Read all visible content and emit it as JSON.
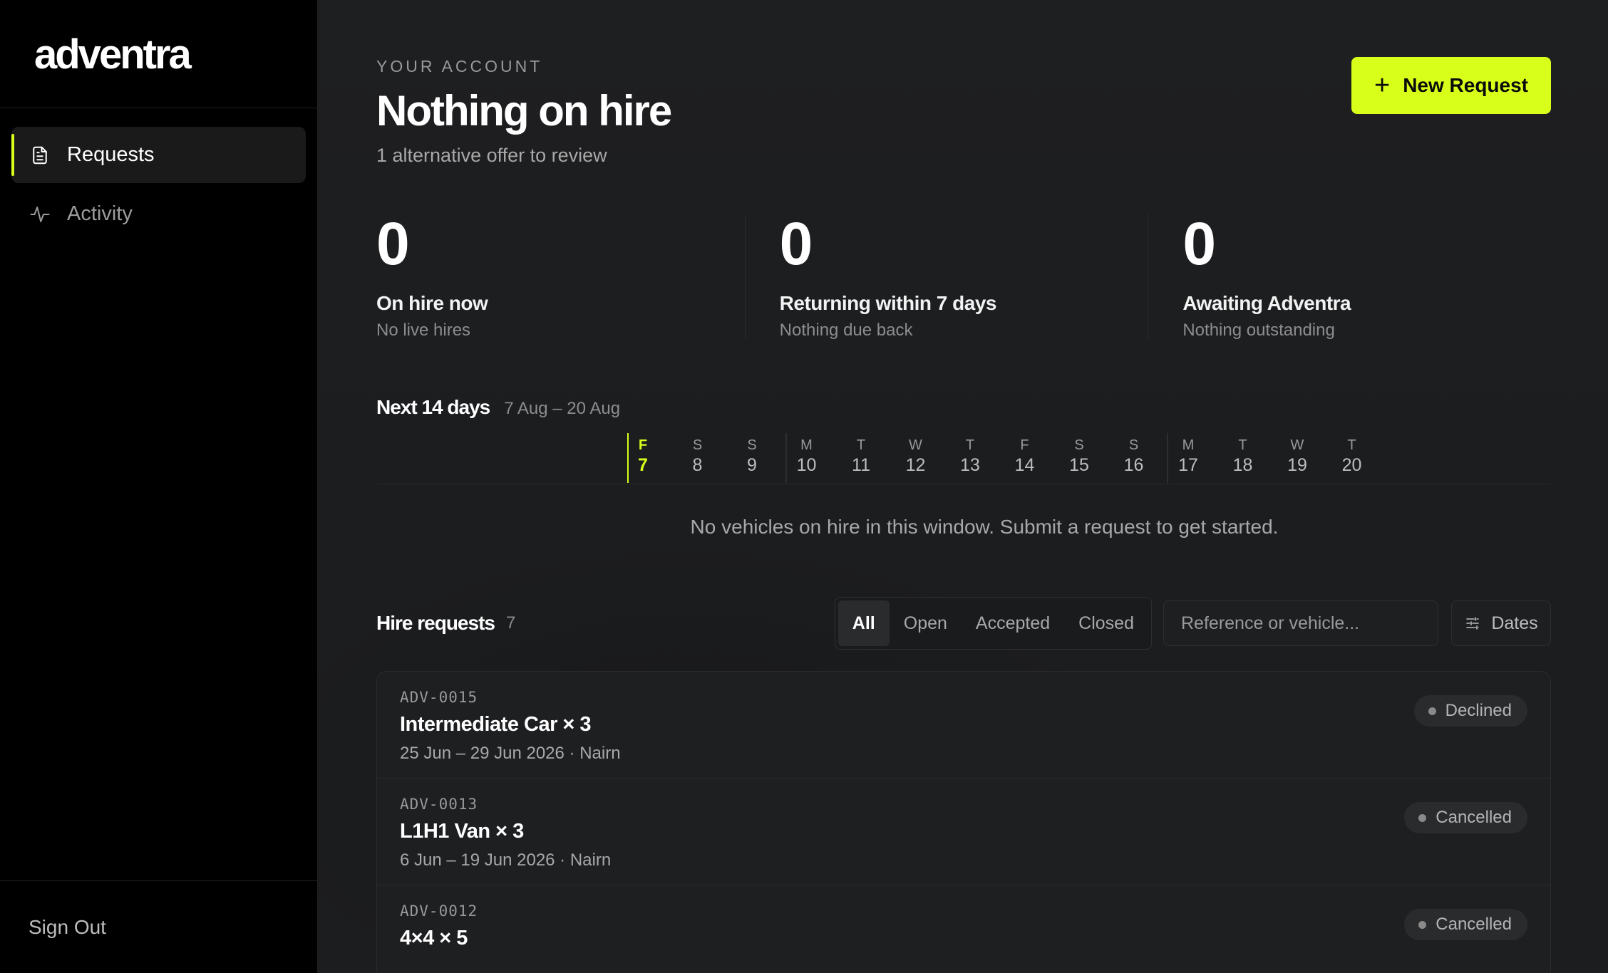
{
  "brand": {
    "logo": "adventra"
  },
  "sidebar": {
    "items": [
      {
        "label": "Requests",
        "icon": "document-icon",
        "active": true
      },
      {
        "label": "Activity",
        "icon": "activity-icon",
        "active": false
      }
    ],
    "sign_out": "Sign Out"
  },
  "header": {
    "eyebrow": "YOUR ACCOUNT",
    "title": "Nothing on hire",
    "subtitle": "1 alternative offer to review",
    "new_request": "New Request"
  },
  "stats": [
    {
      "value": "0",
      "label": "On hire now",
      "sub": "No live hires"
    },
    {
      "value": "0",
      "label": "Returning within 7 days",
      "sub": "Nothing due back"
    },
    {
      "value": "0",
      "label": "Awaiting Adventra",
      "sub": "Nothing outstanding"
    }
  ],
  "window": {
    "title": "Next 14 days",
    "range": "7 Aug – 20 Aug",
    "days": [
      {
        "dow": "F",
        "num": "7",
        "today": true
      },
      {
        "dow": "S",
        "num": "8"
      },
      {
        "dow": "S",
        "num": "9"
      },
      {
        "dow": "M",
        "num": "10"
      },
      {
        "dow": "T",
        "num": "11"
      },
      {
        "dow": "W",
        "num": "12"
      },
      {
        "dow": "T",
        "num": "13"
      },
      {
        "dow": "F",
        "num": "14"
      },
      {
        "dow": "S",
        "num": "15"
      },
      {
        "dow": "S",
        "num": "16"
      },
      {
        "dow": "M",
        "num": "17"
      },
      {
        "dow": "T",
        "num": "18"
      },
      {
        "dow": "W",
        "num": "19"
      },
      {
        "dow": "T",
        "num": "20"
      }
    ],
    "empty": "No vehicles on hire in this window. Submit a request to get started."
  },
  "requests": {
    "title": "Hire requests",
    "count": "7",
    "filters": [
      "All",
      "Open",
      "Accepted",
      "Closed"
    ],
    "active_filter": "All",
    "search_placeholder": "Reference or vehicle...",
    "dates_label": "Dates",
    "rows": [
      {
        "ref": "ADV-0015",
        "vehicle": "Intermediate Car × 3",
        "meta": "25 Jun – 29 Jun 2026 · Nairn",
        "status": "Declined"
      },
      {
        "ref": "ADV-0013",
        "vehicle": "L1H1 Van × 3",
        "meta": "6 Jun – 19 Jun 2026 · Nairn",
        "status": "Cancelled"
      },
      {
        "ref": "ADV-0012",
        "vehicle": "4×4 × 5",
        "meta": "",
        "status": "Cancelled"
      }
    ]
  },
  "colors": {
    "accent": "#d8ff1a",
    "sidebar_bg": "#000000",
    "main_bg": "#1c1d1f"
  }
}
